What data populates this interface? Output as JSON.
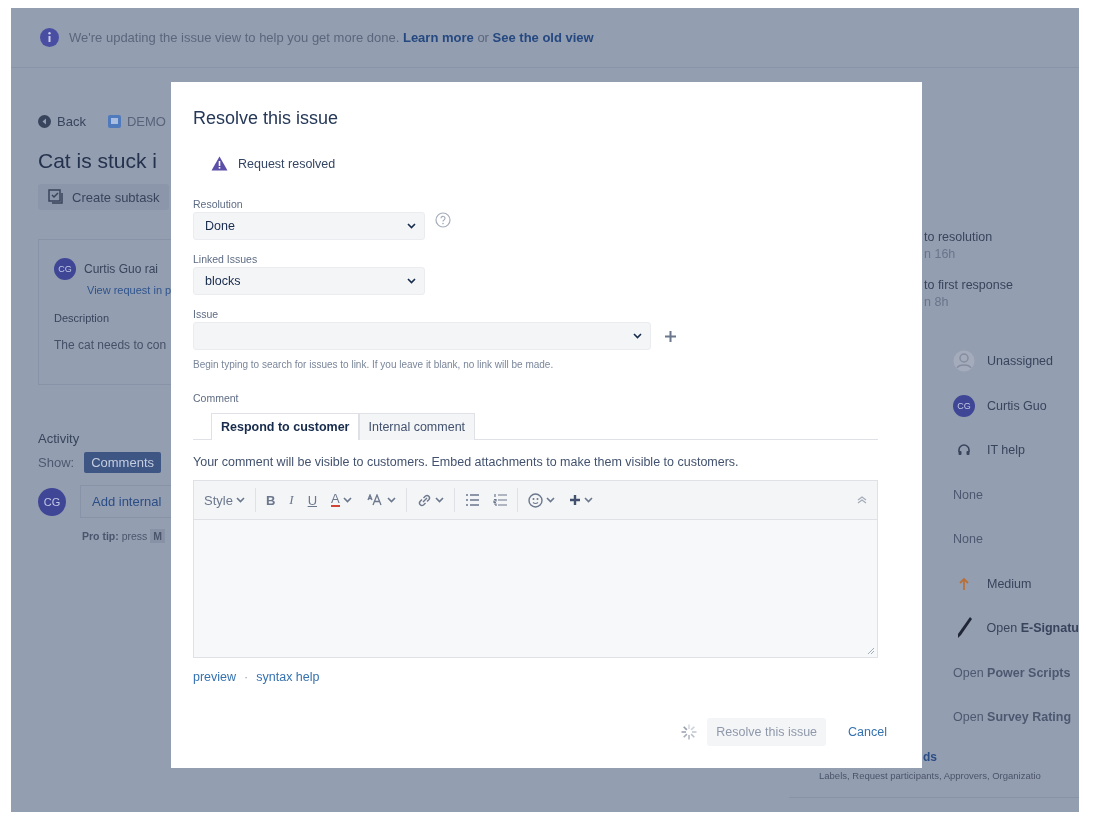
{
  "banner": {
    "text": "We're updating the issue view to help you get more done.",
    "link_1": "Learn more",
    "joiner": "or",
    "link_2": "See the old view"
  },
  "breadcrumbs": {
    "back": "Back",
    "project": "DEMO"
  },
  "issue": {
    "title": "Cat is stuck i",
    "create_subtask": "Create subtask"
  },
  "request_card": {
    "avatar": "CG",
    "reporter": "Curtis Guo rai",
    "view_link": "View request in p",
    "description_label": "Description",
    "description": "The cat needs to con"
  },
  "activity": {
    "title": "Activity",
    "show_label": "Show:",
    "filter": "Comments",
    "avatar": "CG",
    "add_comment": "Add internal",
    "pro_tip": "**Pro tip:** press",
    "key": "M"
  },
  "sla": [
    {
      "label": "to resolution",
      "time": "n 16h"
    },
    {
      "label": "to first response",
      "time": "n 8h"
    }
  ],
  "details": [
    {
      "kind": "empty-avatar",
      "value": "Unassigned"
    },
    {
      "kind": "avatar",
      "initials": "CG",
      "value": "Curtis Guo"
    },
    {
      "kind": "headset",
      "value": "IT help"
    },
    {
      "kind": "plain",
      "value": "None"
    },
    {
      "kind": "plain",
      "value": "None"
    },
    {
      "kind": "priority",
      "value": "Medium"
    },
    {
      "kind": "pen",
      "value": "Open **E-Signatu**"
    },
    {
      "kind": "plain",
      "value": "Open **Power Scripts**"
    },
    {
      "kind": "plain",
      "value": "Open **Survey Rating**"
    }
  ],
  "more_fields": {
    "title": "ds",
    "subtitle": "Labels, Request participants, Approvers, Organizatio"
  },
  "dialog": {
    "title": "Resolve this issue",
    "notice": "Request resolved",
    "resolution": {
      "label": "Resolution",
      "value": "Done"
    },
    "linked_issues": {
      "label": "Linked Issues",
      "value": "blocks"
    },
    "issue": {
      "label": "Issue",
      "hint": "Begin typing to search for issues to link. If you leave it blank, no link will be made."
    },
    "comment_label": "Comment",
    "tabs": [
      {
        "label": "Respond to customer",
        "selected": true
      },
      {
        "label": "Internal comment",
        "selected": false
      }
    ],
    "visibility_note": "Your comment will be visible to customers. Embed attachments to make them visible to customers.",
    "toolbar": [
      [
        {
          "kind": "style-menu",
          "label": "Style",
          "caret": true
        }
      ],
      [
        {
          "kind": "bold",
          "label": "B",
          "caret": false
        },
        {
          "kind": "italic",
          "label": "I",
          "caret": false
        },
        {
          "kind": "underline",
          "label": "U",
          "caret": false
        },
        {
          "kind": "text-color",
          "label": "A",
          "caret": true
        },
        {
          "kind": "size",
          "caret": true
        }
      ],
      [
        {
          "kind": "link",
          "caret": true
        }
      ],
      [
        {
          "kind": "bullets",
          "caret": false
        },
        {
          "kind": "numbers",
          "caret": false
        }
      ],
      [
        {
          "kind": "emoji",
          "caret": true
        },
        {
          "kind": "insert",
          "caret": true
        }
      ]
    ],
    "links": {
      "preview": "preview",
      "separator": "·",
      "syntax_help": "syntax help"
    },
    "resolve_button": {
      "label": "Resolve this issue",
      "disabled": true,
      "busy": true
    },
    "cancel": "Cancel"
  }
}
